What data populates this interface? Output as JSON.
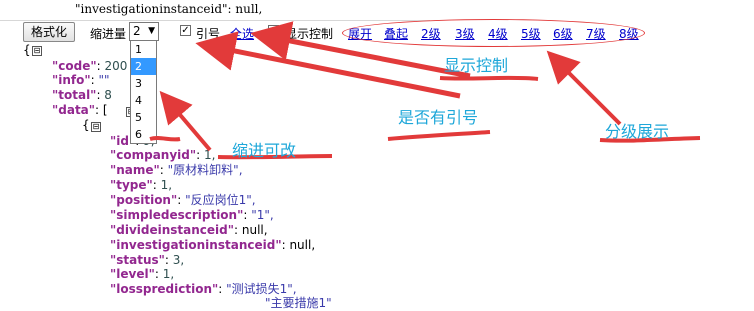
{
  "top_line": {
    "text": "\"investigationinstanceid\": null,"
  },
  "toolbar": {
    "format_button": "格式化",
    "indent_label": "缩进量",
    "indent_value": "2",
    "quote_label": "引号",
    "select_all": "全选",
    "show_control_label": "显示控制",
    "expand": "展开",
    "collapse": "叠起",
    "levels": [
      "2级",
      "3级",
      "4级",
      "5级",
      "6级",
      "7级",
      "8级"
    ]
  },
  "dropdown": {
    "options": [
      "1",
      "2",
      "3",
      "4",
      "5",
      "6"
    ],
    "selected": "2"
  },
  "json": {
    "open_brace": "{",
    "toggle": "⊟",
    "code_key": "\"code\"",
    "code_val": "200",
    "info_key": "\"info\"",
    "info_val": "\"\"",
    "total_key": "\"total\"",
    "total_val": "8",
    "data_key": "\"data\"",
    "data_open": "[",
    "item_open": "{",
    "rows": [
      {
        "key": "\"id\"",
        "sep": ": ",
        "val": "9,",
        "cls": "num"
      },
      {
        "key": "\"companyid\"",
        "sep": ": ",
        "val": "1,",
        "cls": "num"
      },
      {
        "key": "\"name\"",
        "sep": ": ",
        "val": "\"原材料卸料\",",
        "cls": "str"
      },
      {
        "key": "\"type\"",
        "sep": ": ",
        "val": "1,",
        "cls": "num"
      },
      {
        "key": "\"position\"",
        "sep": ": ",
        "val": "\"反应岗位1\",",
        "cls": "str"
      },
      {
        "key": "\"simpledescription\"",
        "sep": ": ",
        "val": "\"1\",",
        "cls": "str"
      },
      {
        "key": "\"divideinstanceid\"",
        "sep": ": ",
        "val": "null,",
        "cls": "nul"
      },
      {
        "key": "\"investigationinstanceid\"",
        "sep": ": ",
        "val": "null,",
        "cls": "nul"
      },
      {
        "key": "\"status\"",
        "sep": ": ",
        "val": "3,",
        "cls": "num"
      },
      {
        "key": "\"level\"",
        "sep": ": ",
        "val": "1,",
        "cls": "num"
      },
      {
        "key": "\"lossprediction\"",
        "sep": ": ",
        "val": "\"测试损失1\",",
        "cls": "str"
      },
      {
        "key": "",
        "sep": "",
        "val": "\"主要措施1\"",
        "cls": "str"
      }
    ]
  },
  "annotations": {
    "show_control": "显示控制",
    "quotes": "是否有引号",
    "indent": "缩进可改",
    "levels": "分级展示"
  },
  "colors": {
    "annotation_text": "#1ea7d9",
    "arrow": "#e23a3a",
    "link": "#0000cc"
  }
}
